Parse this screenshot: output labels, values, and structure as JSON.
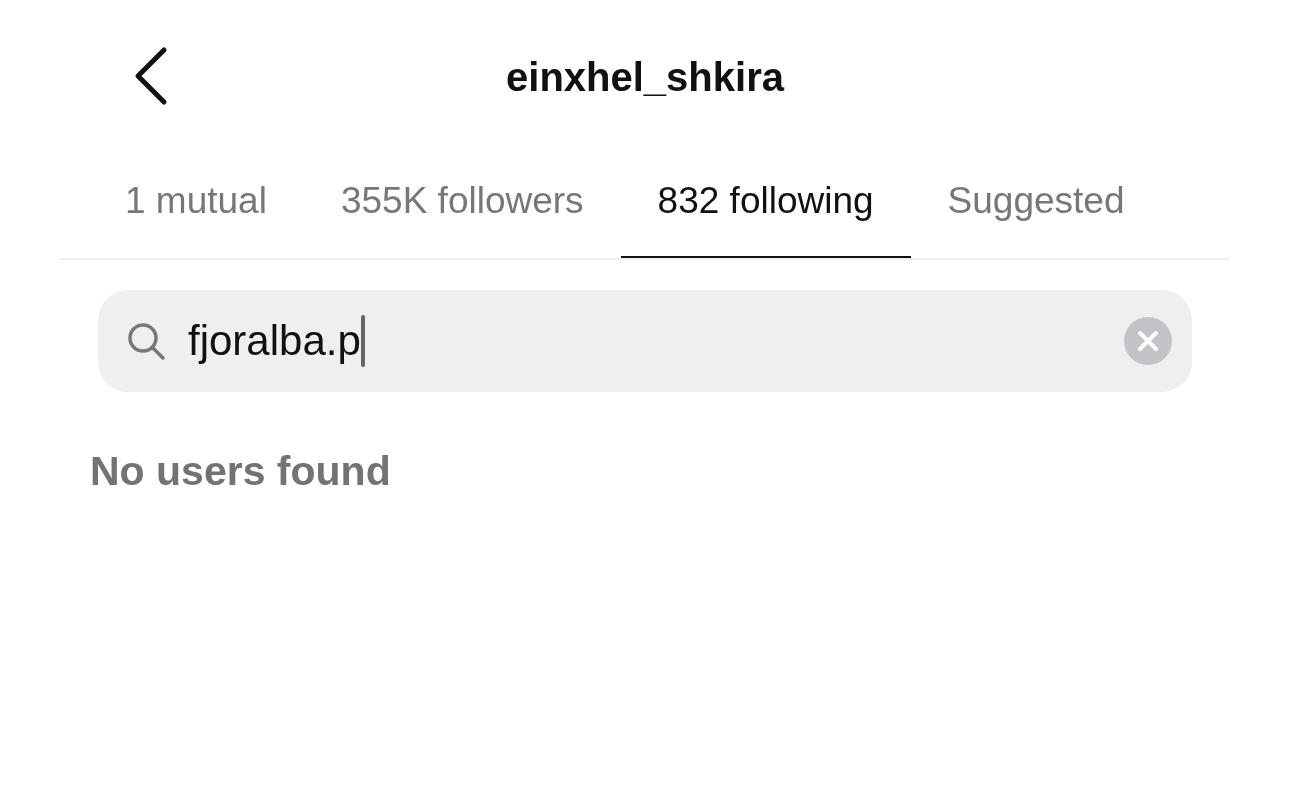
{
  "header": {
    "title": "einxhel_shkira"
  },
  "tabs": [
    {
      "label": "1 mutual",
      "selected": false
    },
    {
      "label": "355K followers",
      "selected": false
    },
    {
      "label": "832 following",
      "selected": true
    },
    {
      "label": "Suggested",
      "selected": false
    }
  ],
  "search": {
    "value": "fjoralba.p"
  },
  "empty_message": "No users found"
}
